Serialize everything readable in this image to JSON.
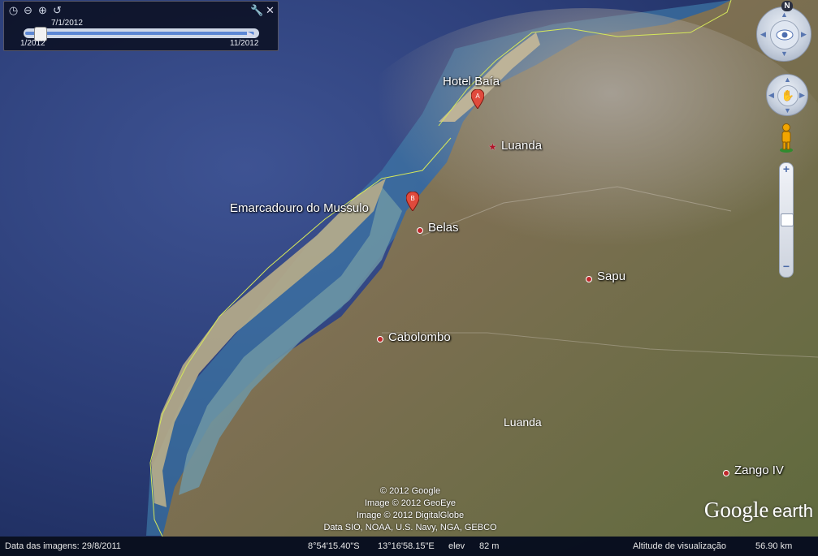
{
  "time_slider": {
    "current_date": "7/1/2012",
    "start_date": "1/2012",
    "end_date": "11/2012"
  },
  "compass": {
    "north_label": "N"
  },
  "places": {
    "hotel_baia": "Hotel Baía",
    "luanda_capital": "Luanda",
    "emarcadouro": "Emarcadouro do Mussulo",
    "belas": "Belas",
    "sapu": "Sapu",
    "cabolombo": "Cabolombo",
    "luanda_region": "Luanda",
    "zango": "Zango IV"
  },
  "markers": {
    "a_label": "A",
    "b_label": "B"
  },
  "attribution": {
    "line1": "© 2012 Google",
    "line2": "Image © 2012 GeoEye",
    "line3": "Image © 2012 DigitalGlobe",
    "line4": "Data SIO, NOAA, U.S. Navy, NGA, GEBCO"
  },
  "logo": {
    "google": "Google",
    "earth": "earth"
  },
  "status": {
    "imagery_date": "Data das imagens: 29/8/2011",
    "latitude": "8°54'15.40\"S",
    "longitude": "13°16'58.15\"E",
    "elev_label": "elev",
    "elev_value": "82 m",
    "eye_alt_label": "Altitude de visualização",
    "eye_alt_value": "56.90 km"
  },
  "colors": {
    "ocean": "#2d3f78",
    "land": "#7b7a55",
    "coastline": "#d6e85a",
    "marker": "#e04a3c"
  },
  "icons": {
    "time": "clock-icon",
    "zoom_out": "magnifier-minus-icon",
    "zoom_in": "magnifier-plus-icon",
    "history": "history-icon",
    "settings": "wrench-icon",
    "close": "close-icon",
    "pegman": "street-view-pegman-icon"
  }
}
